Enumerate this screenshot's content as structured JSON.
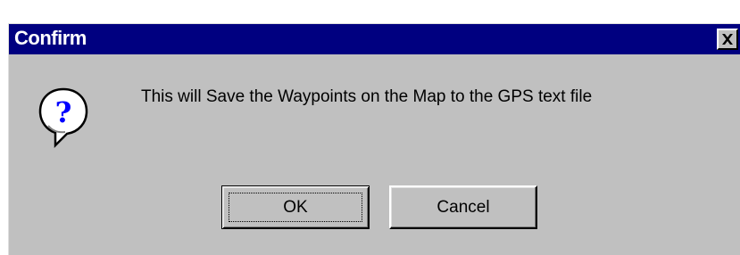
{
  "dialog": {
    "title": "Confirm",
    "close_glyph": "✕",
    "icon": "question-icon",
    "icon_glyph": "?",
    "message": "This will Save the Waypoints on the Map to the GPS text file",
    "buttons": {
      "ok_label": "OK",
      "cancel_label": "Cancel"
    }
  },
  "colors": {
    "titlebar": "#000080",
    "face": "#c0c0c0",
    "icon_glyph": "#0000ff"
  }
}
